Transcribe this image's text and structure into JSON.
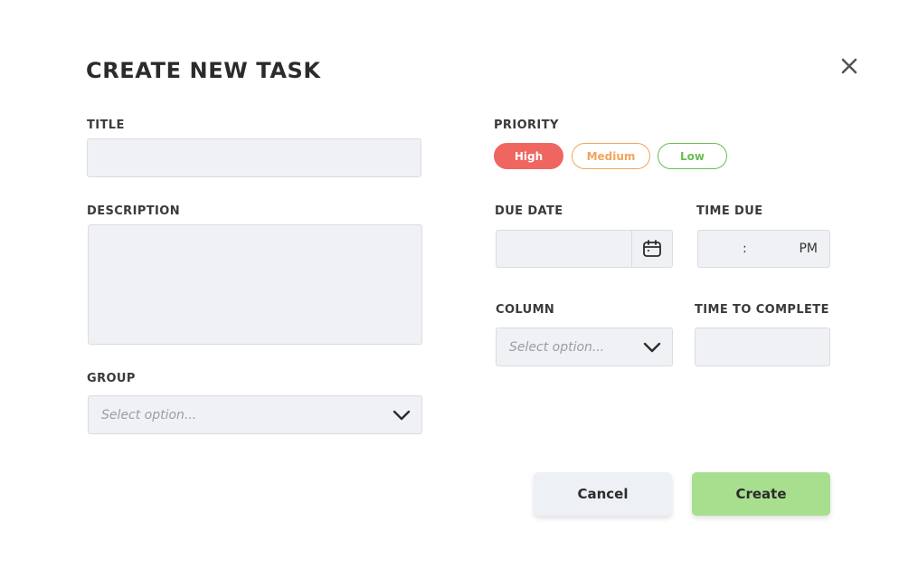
{
  "modal": {
    "title": "CREATE NEW TASK",
    "close_icon": "close-icon"
  },
  "fields": {
    "title_label": "TITLE",
    "title_value": "",
    "description_label": "DESCRIPTION",
    "description_value": "",
    "group_label": "GROUP",
    "group_placeholder": "Select option...",
    "priority_label": "PRIORITY",
    "priority_options": [
      "High",
      "Medium",
      "Low"
    ],
    "priority_selected": "High",
    "due_date_label": "DUE DATE",
    "due_date_value": "",
    "calendar_icon": "calendar-icon",
    "time_due_label": "TIME DUE",
    "time_due_separator": ":",
    "time_due_ampm": "PM",
    "column_label": "COLUMN",
    "column_placeholder": "Select option...",
    "time_to_complete_label": "TIME TO COMPLETE",
    "time_to_complete_value": ""
  },
  "actions": {
    "cancel_label": "Cancel",
    "create_label": "Create"
  },
  "colors": {
    "priority_high": "#ef6660",
    "priority_medium": "#f3a35b",
    "priority_low": "#6bbd52",
    "create_button": "#a7df8f",
    "cancel_button": "#edf0f4",
    "field_background": "#eff1f4"
  }
}
